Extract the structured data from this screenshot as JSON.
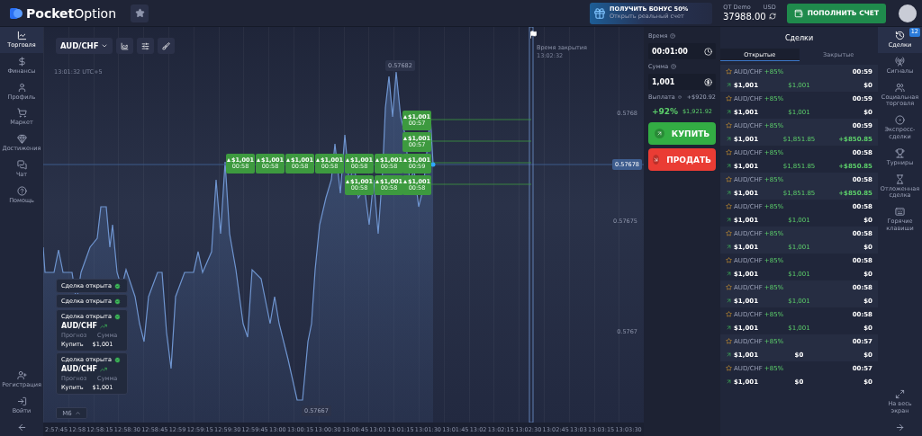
{
  "header": {
    "logo": {
      "bold": "Pocket",
      "light": "Option"
    },
    "bonus": {
      "title": "ПОЛУЧИТЬ БОНУС 50%",
      "subtitle": "Открыть реальный счет"
    },
    "account": {
      "type": "QT Demo",
      "currency": "USD",
      "balance": "37988.00"
    },
    "deposit_button": "ПОПОЛНИТЬ СЧЕТ"
  },
  "left_nav": {
    "items": [
      {
        "label": "Торговля",
        "selected": true
      },
      {
        "label": "Финансы",
        "selected": false
      },
      {
        "label": "Профиль",
        "selected": false
      },
      {
        "label": "Маркет",
        "selected": false
      },
      {
        "label": "Достижения",
        "selected": false
      },
      {
        "label": "Чат",
        "selected": false
      },
      {
        "label": "Помощь",
        "selected": false
      }
    ],
    "bottom_items": [
      "Регистрация",
      "Войти"
    ]
  },
  "chart": {
    "asset": "AUD/CHF",
    "clock": "13:01:32 UTC+5",
    "close_time": {
      "label": "Время закрытия",
      "time": "13:02:32"
    },
    "high": "0.57682",
    "low": "0.57667",
    "current_price": "0.57678",
    "price_labels": [
      "0.5768",
      "0.57675",
      "0.5767"
    ],
    "timeframe": "M6",
    "time_labels": [
      "2:57:45",
      "12:58",
      "12:58:15",
      "12:58:30",
      "12:58:45",
      "12:59",
      "12:59:15",
      "12:59:30",
      "12:59:45",
      "13:00",
      "13:00:15",
      "13:00:30",
      "13:00:45",
      "13:01",
      "13:01:15",
      "13:01:30",
      "13:01:45",
      "13:02",
      "13:02:15",
      "13:02:30",
      "13:02:45",
      "13:03",
      "13:03:15",
      "13:03:30"
    ],
    "markers": [
      {
        "amount": "$1,001",
        "timer": "00:57"
      },
      {
        "amount": "$1,001",
        "timer": "00:57"
      },
      {
        "amount": "$1,001",
        "timer": "00:58"
      },
      {
        "amount": "$1,001",
        "timer": "00:58"
      },
      {
        "amount": "$1,001",
        "timer": "00:58"
      },
      {
        "amount": "$1,001",
        "timer": "00:58"
      },
      {
        "amount": "$1,001",
        "timer": "00:58"
      },
      {
        "amount": "$1,001",
        "timer": "00:58"
      },
      {
        "amount": "$1,001",
        "timer": "00:59"
      },
      {
        "amount": "$1,001",
        "timer": "00:58"
      },
      {
        "amount": "$1,001",
        "timer": "00:58"
      },
      {
        "amount": "$1,001",
        "timer": "00:58"
      }
    ]
  },
  "notifications": [
    {
      "title": "Сделка открыта",
      "expanded": false
    },
    {
      "title": "Сделка открыта",
      "expanded": false
    },
    {
      "title": "Сделка открыта",
      "expanded": true,
      "asset": "AUD/CHF",
      "forecast_label": "Прогноз",
      "forecast": "Купить",
      "sum_label": "Сумма",
      "sum": "$1,001"
    },
    {
      "title": "Сделка открыта",
      "expanded": true,
      "asset": "AUD/CHF",
      "forecast_label": "Прогноз",
      "forecast": "Купить",
      "sum_label": "Сумма",
      "sum": "$1,001"
    }
  ],
  "trade_panel": {
    "time_label": "Время",
    "time": "00:01:00",
    "sum_label": "Сумма",
    "sum": "1,001",
    "payout_label": "Выплата",
    "payout_profit": "+$920.92",
    "payout_percent": "+92%",
    "payout_total": "$1,921.92",
    "buy": "КУПИТЬ",
    "sell": "ПРОДАТЬ"
  },
  "deals": {
    "title": "Сделки",
    "tabs": [
      {
        "label": "Открытые",
        "selected": true
      },
      {
        "label": "Закрытые",
        "selected": false
      }
    ],
    "rows": [
      {
        "asset": "AUD/CHF",
        "payout": "+85%",
        "amount": "$1,001",
        "value": "$1,001",
        "value_positive": true,
        "time": "00:59",
        "profit": "$0",
        "profit_positive": false
      },
      {
        "asset": "AUD/CHF",
        "payout": "+85%",
        "amount": "$1,001",
        "value": "$1,001",
        "value_positive": true,
        "time": "00:59",
        "profit": "$0",
        "profit_positive": false
      },
      {
        "asset": "AUD/CHF",
        "payout": "+85%",
        "amount": "$1,001",
        "value": "$1,851.85",
        "value_positive": true,
        "time": "00:59",
        "profit": "+$850.85",
        "profit_positive": true
      },
      {
        "asset": "AUD/CHF",
        "payout": "+85%",
        "amount": "$1,001",
        "value": "$1,851.85",
        "value_positive": true,
        "time": "00:58",
        "profit": "+$850.85",
        "profit_positive": true
      },
      {
        "asset": "AUD/CHF",
        "payout": "+85%",
        "amount": "$1,001",
        "value": "$1,851.85",
        "value_positive": true,
        "time": "00:58",
        "profit": "+$850.85",
        "profit_positive": true
      },
      {
        "asset": "AUD/CHF",
        "payout": "+85%",
        "amount": "$1,001",
        "value": "$1,001",
        "value_positive": true,
        "time": "00:58",
        "profit": "$0",
        "profit_positive": false
      },
      {
        "asset": "AUD/CHF",
        "payout": "+85%",
        "amount": "$1,001",
        "value": "$1,001",
        "value_positive": true,
        "time": "00:58",
        "profit": "$0",
        "profit_positive": false
      },
      {
        "asset": "AUD/CHF",
        "payout": "+85%",
        "amount": "$1,001",
        "value": "$1,001",
        "value_positive": true,
        "time": "00:58",
        "profit": "$0",
        "profit_positive": false
      },
      {
        "asset": "AUD/CHF",
        "payout": "+85%",
        "amount": "$1,001",
        "value": "$1,001",
        "value_positive": true,
        "time": "00:58",
        "profit": "$0",
        "profit_positive": false
      },
      {
        "asset": "AUD/CHF",
        "payout": "+85%",
        "amount": "$1,001",
        "value": "$1,001",
        "value_positive": true,
        "time": "00:58",
        "profit": "$0",
        "profit_positive": false
      },
      {
        "asset": "AUD/CHF",
        "payout": "+85%",
        "amount": "$1,001",
        "value": "$0",
        "value_positive": false,
        "time": "00:57",
        "profit": "$0",
        "profit_positive": false
      },
      {
        "asset": "AUD/CHF",
        "payout": "+85%",
        "amount": "$1,001",
        "value": "$0",
        "value_positive": false,
        "time": "00:57",
        "profit": "$0",
        "profit_positive": false
      }
    ]
  },
  "right_nav": {
    "items": [
      {
        "label": "Сделки",
        "selected": true,
        "badge": "12"
      },
      {
        "label": "Сигналы",
        "selected": false
      },
      {
        "label": "Социальная торговля",
        "selected": false
      },
      {
        "label": "Экспресс-сделки",
        "selected": false
      },
      {
        "label": "Турниры",
        "selected": false
      },
      {
        "label": "Отложенная сделка",
        "selected": false
      },
      {
        "label": "Горячие клавиши",
        "selected": false
      }
    ],
    "bottom_items": [
      "На весь экран"
    ]
  }
}
